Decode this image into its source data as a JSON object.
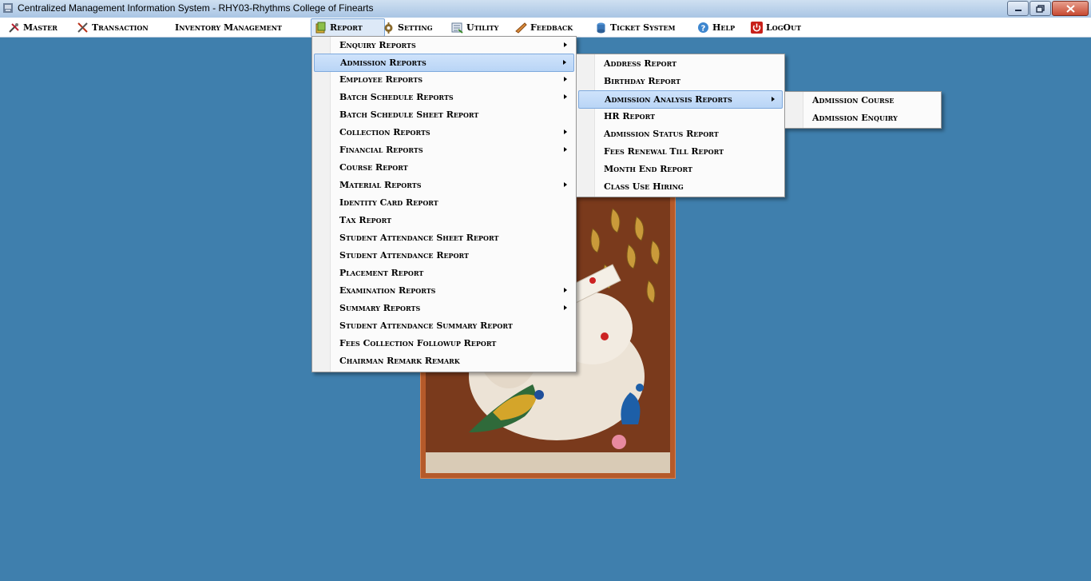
{
  "window": {
    "title": "Centralized Management Information System - RHY03-Rhythms College of Finearts"
  },
  "menubar": {
    "items": [
      {
        "label": "Master",
        "icon": "tools-icon"
      },
      {
        "label": "Transaction",
        "icon": "cross-tools-icon"
      },
      {
        "label": "Inventory Management",
        "icon": ""
      },
      {
        "label": "Report",
        "icon": "report-icon"
      },
      {
        "label": "Setting",
        "icon": "gear-icon"
      },
      {
        "label": "Utility",
        "icon": "utility-icon"
      },
      {
        "label": "Feedback",
        "icon": "feedback-icon"
      },
      {
        "label": "Ticket System",
        "icon": "ticket-icon"
      },
      {
        "label": "Help",
        "icon": "help-icon"
      },
      {
        "label": "LogOut",
        "icon": "power-icon"
      }
    ],
    "active": "Report"
  },
  "report_menu": {
    "items": [
      {
        "label": "Enquiry Reports",
        "submenu": true
      },
      {
        "label": "Admission Reports",
        "submenu": true,
        "highlighted": true
      },
      {
        "label": "Employee Reports",
        "submenu": true
      },
      {
        "label": "Batch Schedule Reports",
        "submenu": true
      },
      {
        "label": "Batch Schedule Sheet Report",
        "submenu": false
      },
      {
        "label": "Collection Reports",
        "submenu": true
      },
      {
        "label": "Financial Reports",
        "submenu": true
      },
      {
        "label": "Course Report",
        "submenu": false
      },
      {
        "label": "Material Reports",
        "submenu": true
      },
      {
        "label": "Identity Card Report",
        "submenu": false
      },
      {
        "label": "Tax Report",
        "submenu": false
      },
      {
        "label": "Student Attendance Sheet Report",
        "submenu": false
      },
      {
        "label": "Student Attendance Report",
        "submenu": false
      },
      {
        "label": "Placement Report",
        "submenu": false
      },
      {
        "label": "Examination Reports",
        "submenu": true
      },
      {
        "label": "Summary Reports",
        "submenu": true
      },
      {
        "label": "Student Attendance Summary Report",
        "submenu": false
      },
      {
        "label": "Fees Collection Followup Report",
        "submenu": false
      },
      {
        "label": "Chairman Remark Remark",
        "submenu": false
      }
    ]
  },
  "admission_menu": {
    "items": [
      {
        "label": "Address Report",
        "submenu": false
      },
      {
        "label": "Birthday Report",
        "submenu": false
      },
      {
        "label": "Admission Analysis Reports",
        "submenu": true,
        "highlighted": true
      },
      {
        "label": "HR Report",
        "submenu": false
      },
      {
        "label": "Admission Status Report",
        "submenu": false
      },
      {
        "label": "Fees Renewal Till Report",
        "submenu": false
      },
      {
        "label": "Month End Report",
        "submenu": false
      },
      {
        "label": "Class Use Hiring",
        "submenu": false
      }
    ]
  },
  "analysis_menu": {
    "items": [
      {
        "label": "Admission Course"
      },
      {
        "label": "Admission Enquiry"
      }
    ]
  },
  "colors": {
    "desktop": "#3f7fad",
    "highlight": "#b9d5f6",
    "picture_border": "#c7612d"
  }
}
